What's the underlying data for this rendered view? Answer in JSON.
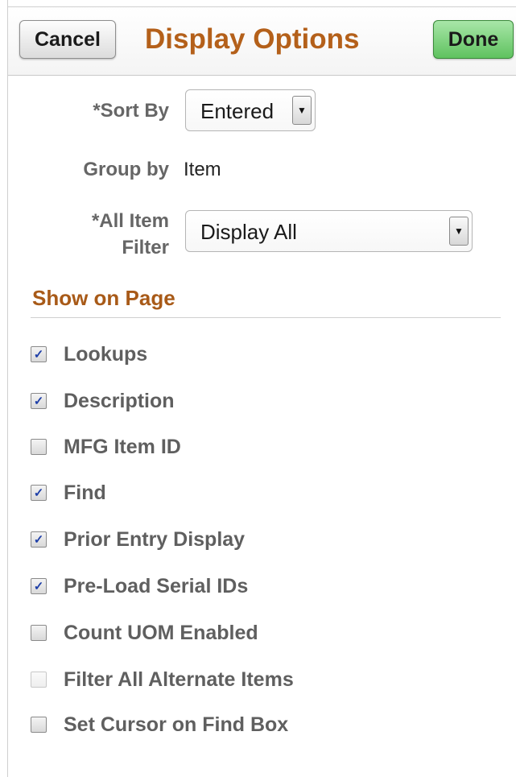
{
  "header": {
    "cancel_label": "Cancel",
    "title": "Display Options",
    "done_label": "Done"
  },
  "form": {
    "sort_by": {
      "label": "*Sort By",
      "value": "Entered"
    },
    "group_by": {
      "label": "Group by",
      "value": "Item"
    },
    "all_item_filter": {
      "label_line1": "*All Item",
      "label_line2": "Filter",
      "value": "Display All"
    }
  },
  "show_on_page": {
    "title": "Show on Page",
    "options": [
      {
        "label": "Lookups",
        "checked": true,
        "enabled": true
      },
      {
        "label": "Description",
        "checked": true,
        "enabled": true
      },
      {
        "label": "MFG Item ID",
        "checked": false,
        "enabled": true
      },
      {
        "label": "Find",
        "checked": true,
        "enabled": true
      },
      {
        "label": "Prior Entry Display",
        "checked": true,
        "enabled": true
      },
      {
        "label": "Pre-Load Serial IDs",
        "checked": true,
        "enabled": true
      },
      {
        "label": "Count UOM Enabled",
        "checked": false,
        "enabled": true
      },
      {
        "label": "Filter All Alternate Items",
        "checked": false,
        "enabled": false
      },
      {
        "label": "Set Cursor on Find Box",
        "checked": false,
        "enabled": true
      }
    ]
  },
  "colors": {
    "title": "#b4601a",
    "section_title": "#a85a18",
    "done_button": "#5fc25f",
    "checkmark": "#1e3fa8"
  }
}
